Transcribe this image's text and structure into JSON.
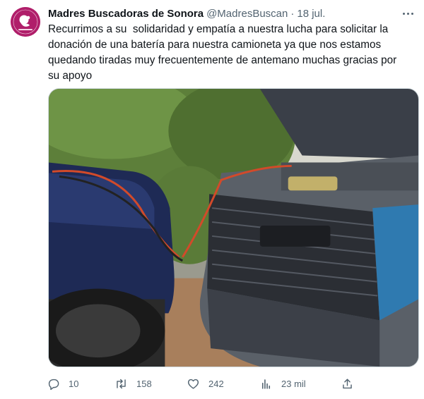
{
  "author": {
    "name": "Madres Buscadoras de Sonora",
    "handle": "@MadresBuscan",
    "separator": "·",
    "date": "18 jul.",
    "avatar_color": "#b01e6a",
    "avatar_text": "MADRES BUSCADORAS de Sonora AC"
  },
  "tweet": {
    "text": "Recurrimos a su  solidaridad y empatía a nuestra lucha para solicitar la\ndonación de una batería para nuestra camioneta ya que nos estamos\nquedando tiradas muy frecuentemente de antemano muchas gracias por\nsu apoyo"
  },
  "media": {
    "description_icon": "photo",
    "colors": {
      "foliage": "#5d7f3a",
      "blue_truck": "#1e2a55",
      "cables": "#d24a2a"
    }
  },
  "actions": {
    "reply": {
      "icon": "reply-icon",
      "count": "10"
    },
    "retweet": {
      "icon": "retweet-icon",
      "count": "158"
    },
    "like": {
      "icon": "heart-icon",
      "count": "242"
    },
    "views": {
      "icon": "views-icon",
      "count": "23 mil"
    },
    "share": {
      "icon": "share-icon"
    }
  },
  "colors": {
    "text": "#0f1419",
    "secondary": "#536471",
    "border": "#cfd9de"
  }
}
